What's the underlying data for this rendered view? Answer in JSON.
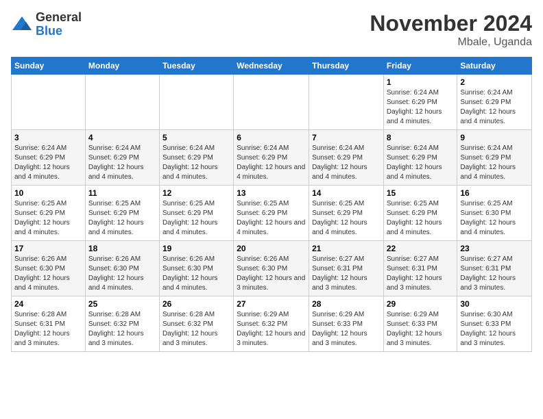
{
  "logo": {
    "general": "General",
    "blue": "Blue"
  },
  "title": "November 2024",
  "location": "Mbale, Uganda",
  "days_of_week": [
    "Sunday",
    "Monday",
    "Tuesday",
    "Wednesday",
    "Thursday",
    "Friday",
    "Saturday"
  ],
  "weeks": [
    [
      {
        "day": "",
        "info": ""
      },
      {
        "day": "",
        "info": ""
      },
      {
        "day": "",
        "info": ""
      },
      {
        "day": "",
        "info": ""
      },
      {
        "day": "",
        "info": ""
      },
      {
        "day": "1",
        "info": "Sunrise: 6:24 AM\nSunset: 6:29 PM\nDaylight: 12 hours and 4 minutes."
      },
      {
        "day": "2",
        "info": "Sunrise: 6:24 AM\nSunset: 6:29 PM\nDaylight: 12 hours and 4 minutes."
      }
    ],
    [
      {
        "day": "3",
        "info": "Sunrise: 6:24 AM\nSunset: 6:29 PM\nDaylight: 12 hours and 4 minutes."
      },
      {
        "day": "4",
        "info": "Sunrise: 6:24 AM\nSunset: 6:29 PM\nDaylight: 12 hours and 4 minutes."
      },
      {
        "day": "5",
        "info": "Sunrise: 6:24 AM\nSunset: 6:29 PM\nDaylight: 12 hours and 4 minutes."
      },
      {
        "day": "6",
        "info": "Sunrise: 6:24 AM\nSunset: 6:29 PM\nDaylight: 12 hours and 4 minutes."
      },
      {
        "day": "7",
        "info": "Sunrise: 6:24 AM\nSunset: 6:29 PM\nDaylight: 12 hours and 4 minutes."
      },
      {
        "day": "8",
        "info": "Sunrise: 6:24 AM\nSunset: 6:29 PM\nDaylight: 12 hours and 4 minutes."
      },
      {
        "day": "9",
        "info": "Sunrise: 6:24 AM\nSunset: 6:29 PM\nDaylight: 12 hours and 4 minutes."
      }
    ],
    [
      {
        "day": "10",
        "info": "Sunrise: 6:25 AM\nSunset: 6:29 PM\nDaylight: 12 hours and 4 minutes."
      },
      {
        "day": "11",
        "info": "Sunrise: 6:25 AM\nSunset: 6:29 PM\nDaylight: 12 hours and 4 minutes."
      },
      {
        "day": "12",
        "info": "Sunrise: 6:25 AM\nSunset: 6:29 PM\nDaylight: 12 hours and 4 minutes."
      },
      {
        "day": "13",
        "info": "Sunrise: 6:25 AM\nSunset: 6:29 PM\nDaylight: 12 hours and 4 minutes."
      },
      {
        "day": "14",
        "info": "Sunrise: 6:25 AM\nSunset: 6:29 PM\nDaylight: 12 hours and 4 minutes."
      },
      {
        "day": "15",
        "info": "Sunrise: 6:25 AM\nSunset: 6:29 PM\nDaylight: 12 hours and 4 minutes."
      },
      {
        "day": "16",
        "info": "Sunrise: 6:25 AM\nSunset: 6:30 PM\nDaylight: 12 hours and 4 minutes."
      }
    ],
    [
      {
        "day": "17",
        "info": "Sunrise: 6:26 AM\nSunset: 6:30 PM\nDaylight: 12 hours and 4 minutes."
      },
      {
        "day": "18",
        "info": "Sunrise: 6:26 AM\nSunset: 6:30 PM\nDaylight: 12 hours and 4 minutes."
      },
      {
        "day": "19",
        "info": "Sunrise: 6:26 AM\nSunset: 6:30 PM\nDaylight: 12 hours and 4 minutes."
      },
      {
        "day": "20",
        "info": "Sunrise: 6:26 AM\nSunset: 6:30 PM\nDaylight: 12 hours and 3 minutes."
      },
      {
        "day": "21",
        "info": "Sunrise: 6:27 AM\nSunset: 6:31 PM\nDaylight: 12 hours and 3 minutes."
      },
      {
        "day": "22",
        "info": "Sunrise: 6:27 AM\nSunset: 6:31 PM\nDaylight: 12 hours and 3 minutes."
      },
      {
        "day": "23",
        "info": "Sunrise: 6:27 AM\nSunset: 6:31 PM\nDaylight: 12 hours and 3 minutes."
      }
    ],
    [
      {
        "day": "24",
        "info": "Sunrise: 6:28 AM\nSunset: 6:31 PM\nDaylight: 12 hours and 3 minutes."
      },
      {
        "day": "25",
        "info": "Sunrise: 6:28 AM\nSunset: 6:32 PM\nDaylight: 12 hours and 3 minutes."
      },
      {
        "day": "26",
        "info": "Sunrise: 6:28 AM\nSunset: 6:32 PM\nDaylight: 12 hours and 3 minutes."
      },
      {
        "day": "27",
        "info": "Sunrise: 6:29 AM\nSunset: 6:32 PM\nDaylight: 12 hours and 3 minutes."
      },
      {
        "day": "28",
        "info": "Sunrise: 6:29 AM\nSunset: 6:33 PM\nDaylight: 12 hours and 3 minutes."
      },
      {
        "day": "29",
        "info": "Sunrise: 6:29 AM\nSunset: 6:33 PM\nDaylight: 12 hours and 3 minutes."
      },
      {
        "day": "30",
        "info": "Sunrise: 6:30 AM\nSunset: 6:33 PM\nDaylight: 12 hours and 3 minutes."
      }
    ]
  ]
}
